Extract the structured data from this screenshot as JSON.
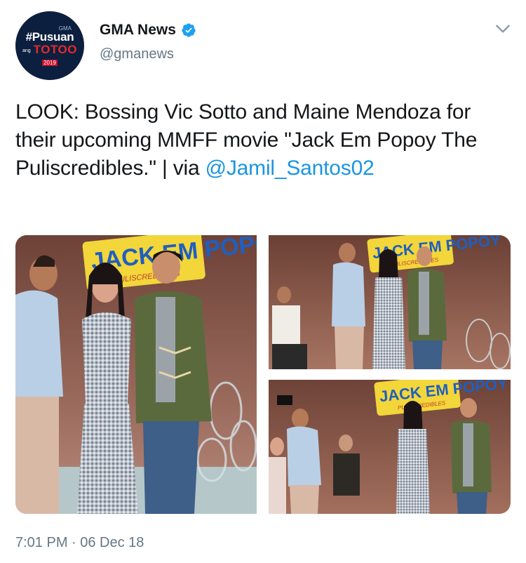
{
  "account": {
    "display_name": "GMA News",
    "handle": "@gmanews",
    "avatar": {
      "top_text": "GMA",
      "line1": "#Pusuan",
      "line2": "TOTOO",
      "small": "ang",
      "year": "2019"
    },
    "verified_icon": "verified-badge-icon"
  },
  "tweet": {
    "text_main": "LOOK: Bossing Vic Sotto and Maine Mendoza for their upcoming MMFF movie \"Jack Em Popoy The Puliscredibles.\" | via ",
    "mention": "@Jamil_Santos02",
    "timestamp": "7:01 PM · 06 Dec 18"
  },
  "media": {
    "photo_1": {
      "logo_text": "JACK EM POPOY",
      "sub": "PULISCREDIBLES"
    },
    "photo_2": {
      "logo_text": "JACK EM POPOY",
      "sub": "PULISCREDIBLES"
    },
    "photo_3": {
      "logo_text": "JACK EM POPOY",
      "sub": "PULISCREDIBLES"
    }
  },
  "colors": {
    "link": "#1b95e0",
    "secondary_text": "#657786",
    "verified": "#1da1f2",
    "backdrop": "#8a5a4e"
  }
}
